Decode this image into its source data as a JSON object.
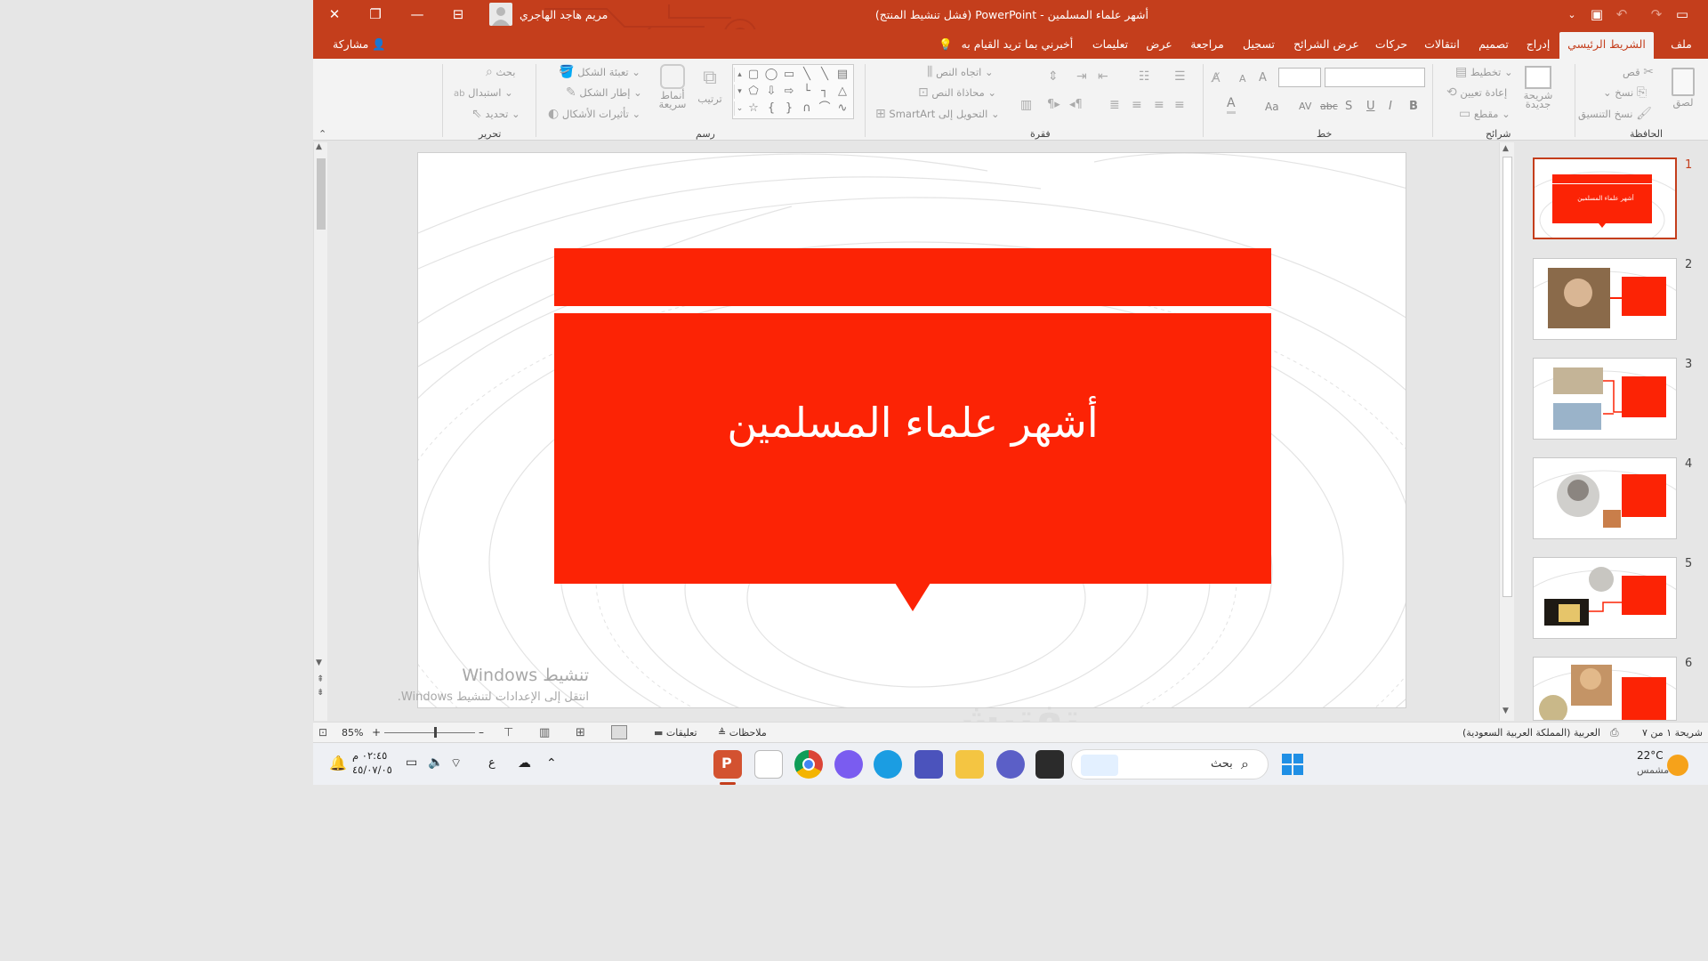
{
  "titlebar": {
    "doc_title": "أشهر علماء المسلمين",
    "separator": "-",
    "app_name": "PowerPoint",
    "status": "(فشل تنشيط المنتج)",
    "user_name": "مريم هاجد الهاجري",
    "close_glyph": "✕",
    "restore_glyph": "❐",
    "minimize_glyph": "—",
    "ribbon_display_glyph": "⊟",
    "qat_more_glyph": "⌄",
    "redo_glyph": "↷",
    "undo_glyph": "↶",
    "save_glyph": "▭",
    "present_glyph": "▣"
  },
  "tabs": [
    {
      "label": "ملف"
    },
    {
      "label": "الشريط الرئيسي"
    },
    {
      "label": "إدراج"
    },
    {
      "label": "تصميم"
    },
    {
      "label": "انتقالات"
    },
    {
      "label": "حركات"
    },
    {
      "label": "عرض الشرائح"
    },
    {
      "label": "تسجيل"
    },
    {
      "label": "مراجعة"
    },
    {
      "label": "عرض"
    },
    {
      "label": "تعليمات"
    }
  ],
  "tell_me": "أخبرني بما تريد القيام به",
  "share_label": "مشاركة",
  "ribbon": {
    "clipboard": {
      "label": "الحافظة",
      "paste": "لصق",
      "cut": "قص",
      "copy": "نسخ",
      "format_painter": "نسخ التنسيق"
    },
    "slides": {
      "label": "شرائح",
      "new_slide_1": "شريحة",
      "new_slide_2": "جديدة",
      "layout": "تخطيط",
      "reset": "إعادة تعيين",
      "section": "مقطع"
    },
    "font": {
      "label": "خط",
      "bold": "B",
      "italic": "I",
      "underline": "U",
      "shadow": "S",
      "strike": "abc",
      "spacing": "AV",
      "case": "Aa",
      "color": "A",
      "grow": "A",
      "shrink": "A"
    },
    "paragraph": {
      "label": "فقرة",
      "text_direction": "اتجاه النص",
      "align_text": "محاذاة النص",
      "smartart": "التحويل إلى SmartArt"
    },
    "drawing": {
      "label": "رسم",
      "arrange": "ترتيب",
      "quick_styles_1": "أنماط",
      "quick_styles_2": "سريعة",
      "shape_fill": "تعبئة الشكل",
      "shape_outline": "إطار الشكل",
      "shape_effects": "تأثيرات الأشكال"
    },
    "editing": {
      "label": "تحرير",
      "find": "بحث",
      "replace": "استبدال",
      "select": "تحديد"
    }
  },
  "slide": {
    "title": "أشهر علماء المسلمين",
    "colors": {
      "banner": "#fc2305"
    }
  },
  "watermark": {
    "title": "تنشيط Windows",
    "subtitle": "انتقل إلى الإعدادات لتنشيط Windows."
  },
  "thumbnails": [
    {
      "num": "1",
      "selected": true,
      "label": "أشهر علماء المسلمين"
    },
    {
      "num": "2",
      "selected": false
    },
    {
      "num": "3",
      "selected": false
    },
    {
      "num": "4",
      "selected": false
    },
    {
      "num": "5",
      "selected": false
    },
    {
      "num": "6",
      "selected": false
    }
  ],
  "statusbar": {
    "slide_info": "شريحة ١ من ٧",
    "language": "العربية (المملكة العربية السعودية)",
    "notes": "ملاحظات",
    "comments": "تعليقات",
    "zoom": "85%",
    "zoom_minus": "–",
    "zoom_plus": "+"
  },
  "taskbar": {
    "weather_temp": "22°C",
    "weather_desc": "مشمس",
    "search_placeholder": "بحث",
    "time": "٠٢:٤٥ م",
    "date": "٤٥/٠٧/٠٥",
    "lang": "ع"
  },
  "ghost_logo": "تفتيش"
}
